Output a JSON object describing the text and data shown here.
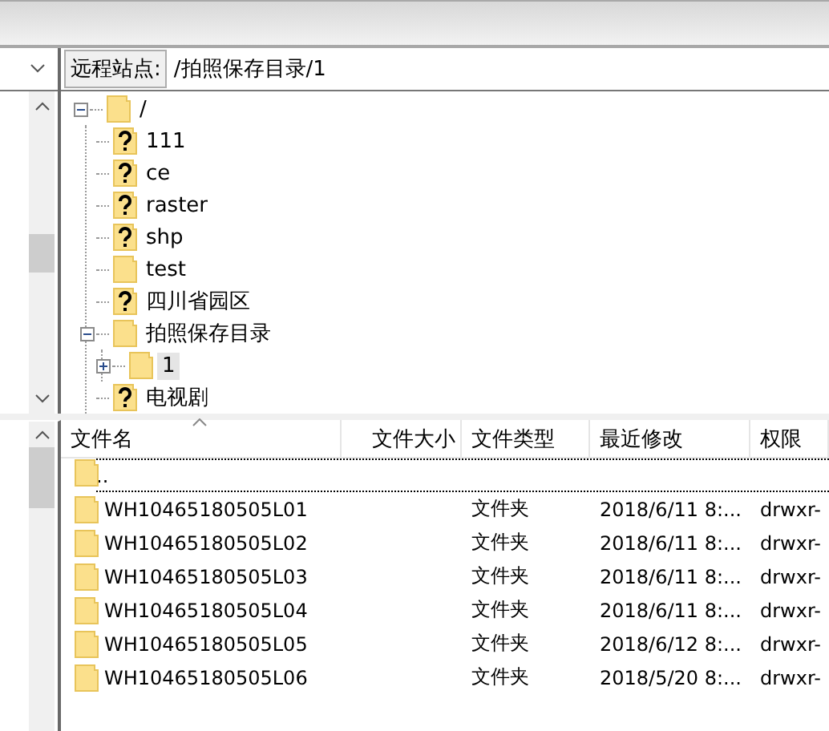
{
  "remote_site": {
    "label": "远程站点:",
    "path": "/拍照保存目录/1"
  },
  "tree": [
    {
      "label": "/",
      "kind": "folder",
      "expanded": true,
      "selected": false,
      "children": [
        {
          "label": "111",
          "kind": "unknown",
          "selected": false
        },
        {
          "label": "ce",
          "kind": "unknown",
          "selected": false
        },
        {
          "label": "raster",
          "kind": "unknown",
          "selected": false
        },
        {
          "label": "shp",
          "kind": "unknown",
          "selected": false
        },
        {
          "label": "test",
          "kind": "folder",
          "selected": false
        },
        {
          "label": "四川省园区",
          "kind": "unknown",
          "selected": false
        },
        {
          "label": "拍照保存目录",
          "kind": "folder",
          "expanded": true,
          "selected": false,
          "children": [
            {
              "label": "1",
              "kind": "folder",
              "expanded": false,
              "has_children": true,
              "selected": true
            }
          ]
        },
        {
          "label": "电视剧",
          "kind": "unknown",
          "selected": false
        }
      ]
    }
  ],
  "file_list": {
    "columns": [
      "文件名",
      "文件大小",
      "文件类型",
      "最近修改",
      "权限"
    ],
    "rows": [
      {
        "name": "..",
        "size": "",
        "type": "",
        "modified": "",
        "permissions": "",
        "focused": true
      },
      {
        "name": "WH10465180505L01",
        "type": "文件夹",
        "modified": "2018/6/11 8:...",
        "permissions": "drwxr-",
        "focused": false
      },
      {
        "name": "WH10465180505L02",
        "type": "文件夹",
        "modified": "2018/6/11 8:...",
        "permissions": "drwxr-",
        "focused": false
      },
      {
        "name": "WH10465180505L03",
        "type": "文件夹",
        "modified": "2018/6/11 8:...",
        "permissions": "drwxr-",
        "focused": false
      },
      {
        "name": "WH10465180505L04",
        "type": "文件夹",
        "modified": "2018/6/11 8:...",
        "permissions": "drwxr-",
        "focused": false
      },
      {
        "name": "WH10465180505L05",
        "type": "文件夹",
        "modified": "2018/6/12 8:...",
        "permissions": "drwxr-",
        "focused": false
      },
      {
        "name": "WH10465180505L06",
        "type": "文件夹",
        "modified": "2018/5/20 8:...",
        "permissions": "drwxr-",
        "focused": false
      }
    ]
  }
}
